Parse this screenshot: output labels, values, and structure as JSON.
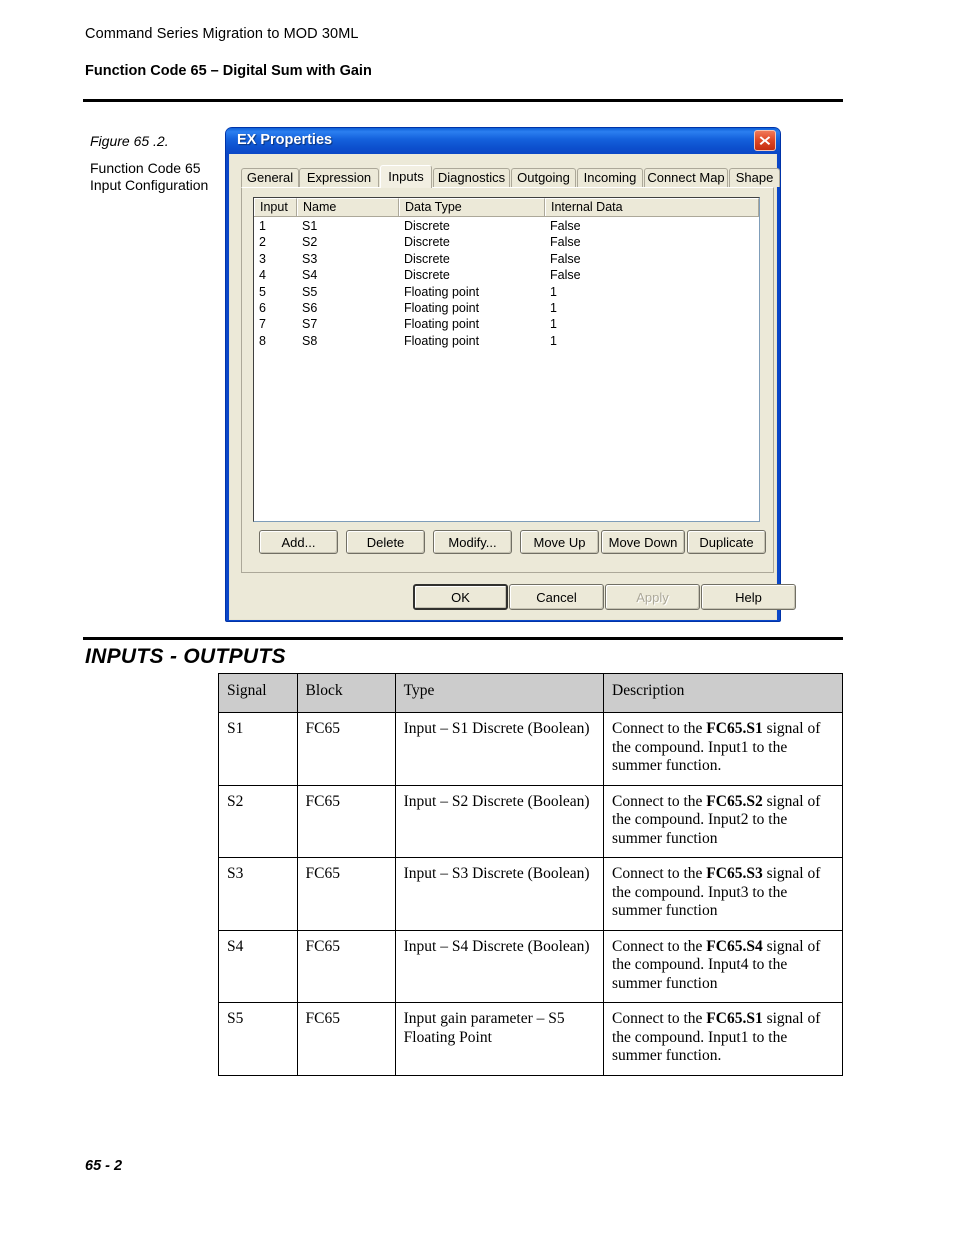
{
  "page": {
    "running_head": "Command Series Migration to MOD 30ML",
    "section_heading": "Function Code 65 – Digital Sum with Gain",
    "folio": "65 - 2"
  },
  "figure": {
    "number": "Figure 65 .2.",
    "caption": "Function Code 65 Input Configuration"
  },
  "dialog": {
    "title": "EX Properties",
    "close_icon": "close-icon",
    "tabs": [
      {
        "label": "General",
        "active": false
      },
      {
        "label": "Expression",
        "active": false
      },
      {
        "label": "Inputs",
        "active": true
      },
      {
        "label": "Diagnostics",
        "active": false
      },
      {
        "label": "Outgoing",
        "active": false
      },
      {
        "label": "Incoming",
        "active": false
      },
      {
        "label": "Connect Map",
        "active": false
      },
      {
        "label": "Shape",
        "active": false
      }
    ],
    "list": {
      "columns": [
        "Input",
        "Name",
        "Data Type",
        "Internal Data"
      ],
      "rows": [
        {
          "input": "1",
          "name": "S1",
          "type": "Discrete",
          "internal": "False"
        },
        {
          "input": "2",
          "name": "S2",
          "type": "Discrete",
          "internal": "False"
        },
        {
          "input": "3",
          "name": "S3",
          "type": "Discrete",
          "internal": "False"
        },
        {
          "input": "4",
          "name": "S4",
          "type": "Discrete",
          "internal": "False"
        },
        {
          "input": "5",
          "name": "S5",
          "type": "Floating point",
          "internal": "1"
        },
        {
          "input": "6",
          "name": "S6",
          "type": "Floating point",
          "internal": "1"
        },
        {
          "input": "7",
          "name": "S7",
          "type": "Floating point",
          "internal": "1"
        },
        {
          "input": "8",
          "name": "S8",
          "type": "Floating point",
          "internal": "1"
        }
      ]
    },
    "list_buttons": [
      {
        "label": "Add...",
        "enabled": true
      },
      {
        "label": "Delete",
        "enabled": true
      },
      {
        "label": "Modify...",
        "enabled": true
      },
      {
        "label": "Move Up",
        "enabled": true
      },
      {
        "label": "Move Down",
        "enabled": true
      },
      {
        "label": "Duplicate",
        "enabled": true
      }
    ],
    "footer_buttons": [
      {
        "label": "OK",
        "enabled": true,
        "default": true
      },
      {
        "label": "Cancel",
        "enabled": true,
        "default": false
      },
      {
        "label": "Apply",
        "enabled": false,
        "default": false
      },
      {
        "label": "Help",
        "enabled": true,
        "default": false
      }
    ],
    "colors": {
      "titlebar_blue": "#1562dd",
      "frame_blue": "#0a46c8",
      "face": "#ece9d8",
      "close_red": "#e04a28"
    }
  },
  "io_section": {
    "title": "INPUTS - OUTPUTS",
    "columns": [
      "Signal",
      "Block",
      "Type",
      "Description"
    ],
    "rows": [
      {
        "signal": "S1",
        "block": "FC65",
        "type": "Input – S1 Discrete (Boolean)",
        "desc_pre": "Connect to the ",
        "desc_bold": "FC65.S1",
        "desc_post": " signal of the compound. Input1 to the summer function."
      },
      {
        "signal": "S2",
        "block": "FC65",
        "type": "Input – S2 Discrete (Boolean)",
        "desc_pre": "Connect to the ",
        "desc_bold": "FC65.S2",
        "desc_post": " signal of the compound. Input2 to the summer function"
      },
      {
        "signal": "S3",
        "block": "FC65",
        "type": "Input –  S3 Discrete (Boolean)",
        "desc_pre": "Connect to the ",
        "desc_bold": "FC65.S3",
        "desc_post": " signal of the compound. Input3 to the summer function"
      },
      {
        "signal": "S4",
        "block": "FC65",
        "type": "Input –  S4 Discrete (Boolean)",
        "desc_pre": "Connect to the ",
        "desc_bold": "FC65.S4",
        "desc_post": " signal of the compound. Input4 to the summer function"
      },
      {
        "signal": "S5",
        "block": "FC65",
        "type": "Input gain parameter – S5 Floating Point",
        "desc_pre": "Connect to the ",
        "desc_bold": "FC65.S1",
        "desc_post": " signal of the compound. Input1 to the summer function."
      }
    ]
  }
}
